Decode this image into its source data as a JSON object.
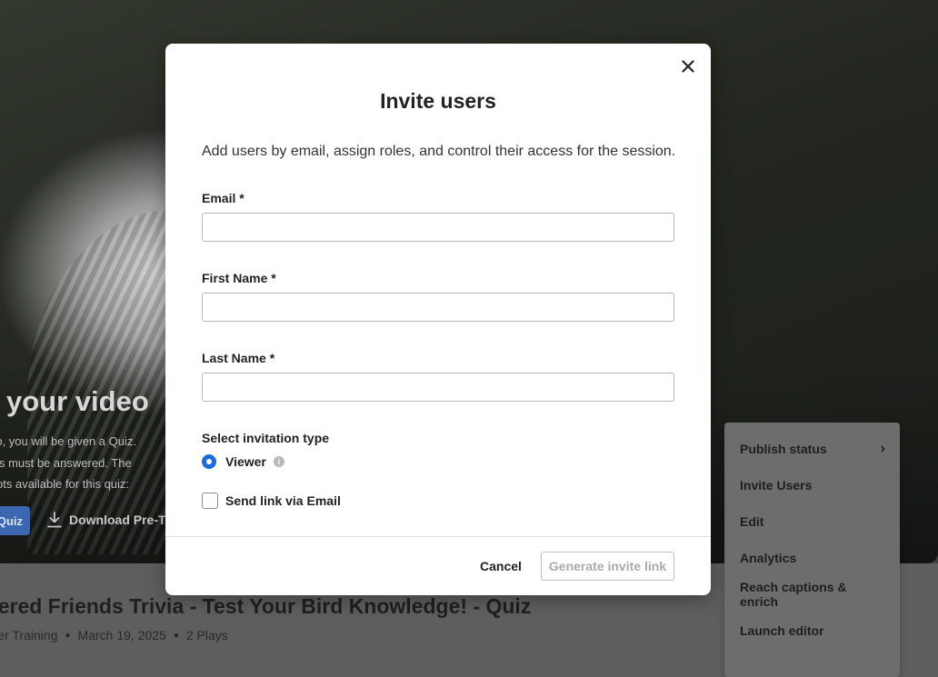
{
  "background": {
    "video_headline": "rt your video",
    "video_desc": [
      "ideo, you will be given a Quiz.",
      "tions must be answered. The",
      "empts available for this quiz:"
    ],
    "quiz_button": "Quiz",
    "download_label": "Download Pre-T",
    "entry_title": "thered Friends Trivia - Test Your Bird Knowledge! - Quiz",
    "meta": {
      "owner": "tomer Training",
      "date": "March 19, 2025",
      "plays": "2 Plays"
    }
  },
  "menu": {
    "items": [
      {
        "label": "Publish status",
        "has_submenu": true
      },
      {
        "label": "Invite Users"
      },
      {
        "label": "Edit"
      },
      {
        "label": "Analytics"
      },
      {
        "label": "Reach captions & enrich"
      },
      {
        "label": "Launch editor"
      }
    ]
  },
  "modal": {
    "title": "Invite users",
    "description": "Add users by email, assign roles, and control their access for the session.",
    "email_label": "Email *",
    "email_value": "",
    "first_name_label": "First Name *",
    "first_name_value": "",
    "last_name_label": "Last Name *",
    "last_name_value": "",
    "invitation_type_label": "Select invitation type",
    "viewer_label": "Viewer",
    "send_email_label": "Send link via Email",
    "cancel_label": "Cancel",
    "generate_label": "Generate invite link"
  },
  "colors": {
    "accent": "#1a6ddd",
    "disabled_text": "#ababab"
  }
}
